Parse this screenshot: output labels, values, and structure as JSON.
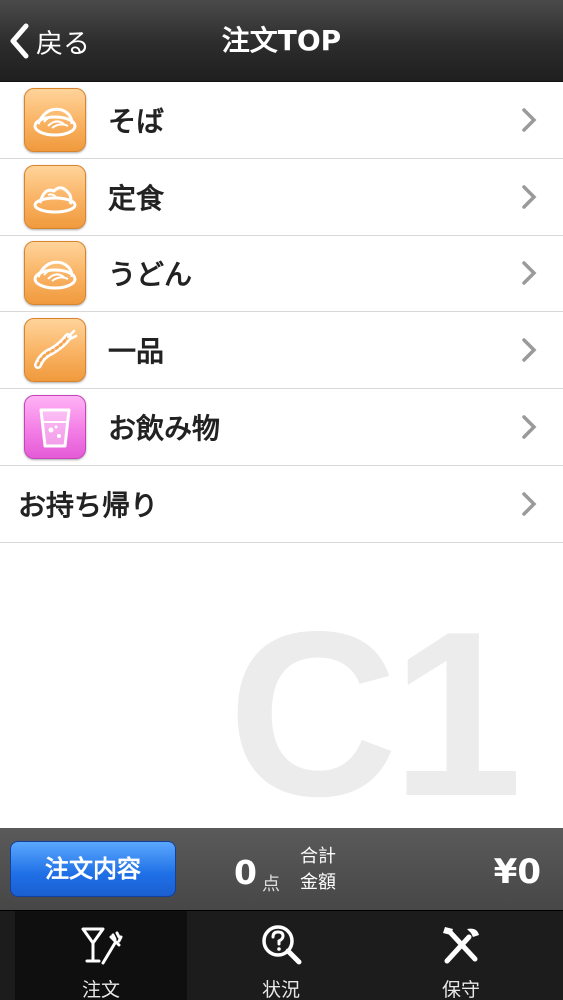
{
  "header": {
    "back_label": "戻る",
    "title": "注文TOP"
  },
  "menu": {
    "items": [
      {
        "label": "そば",
        "icon": "soba-icon",
        "icon_color": "#f9b262"
      },
      {
        "label": "定食",
        "icon": "set-meal-icon",
        "icon_color": "#f9b262"
      },
      {
        "label": "うどん",
        "icon": "udon-icon",
        "icon_color": "#f9b262"
      },
      {
        "label": "一品",
        "icon": "tempura-icon",
        "icon_color": "#f9b262"
      },
      {
        "label": "お飲み物",
        "icon": "drink-icon",
        "icon_color": "#f37ee6"
      },
      {
        "label": "お持ち帰り",
        "icon": null
      }
    ]
  },
  "watermark": "C1",
  "summary": {
    "order_button": "注文内容",
    "count": "0",
    "count_unit": "点",
    "total_label_1": "合計",
    "total_label_2": "金額",
    "total": "¥0"
  },
  "tabs": [
    {
      "label": "注文",
      "icon": "cocktail-fork-icon",
      "active": true
    },
    {
      "label": "状況",
      "icon": "search-question-icon",
      "active": false
    },
    {
      "label": "保守",
      "icon": "tools-icon",
      "active": false
    }
  ],
  "colors": {
    "accent_blue": "#1f6fe6",
    "header_dark": "#2c2c2c",
    "icon_orange": "#f9b262",
    "icon_pink": "#f37ee6"
  }
}
